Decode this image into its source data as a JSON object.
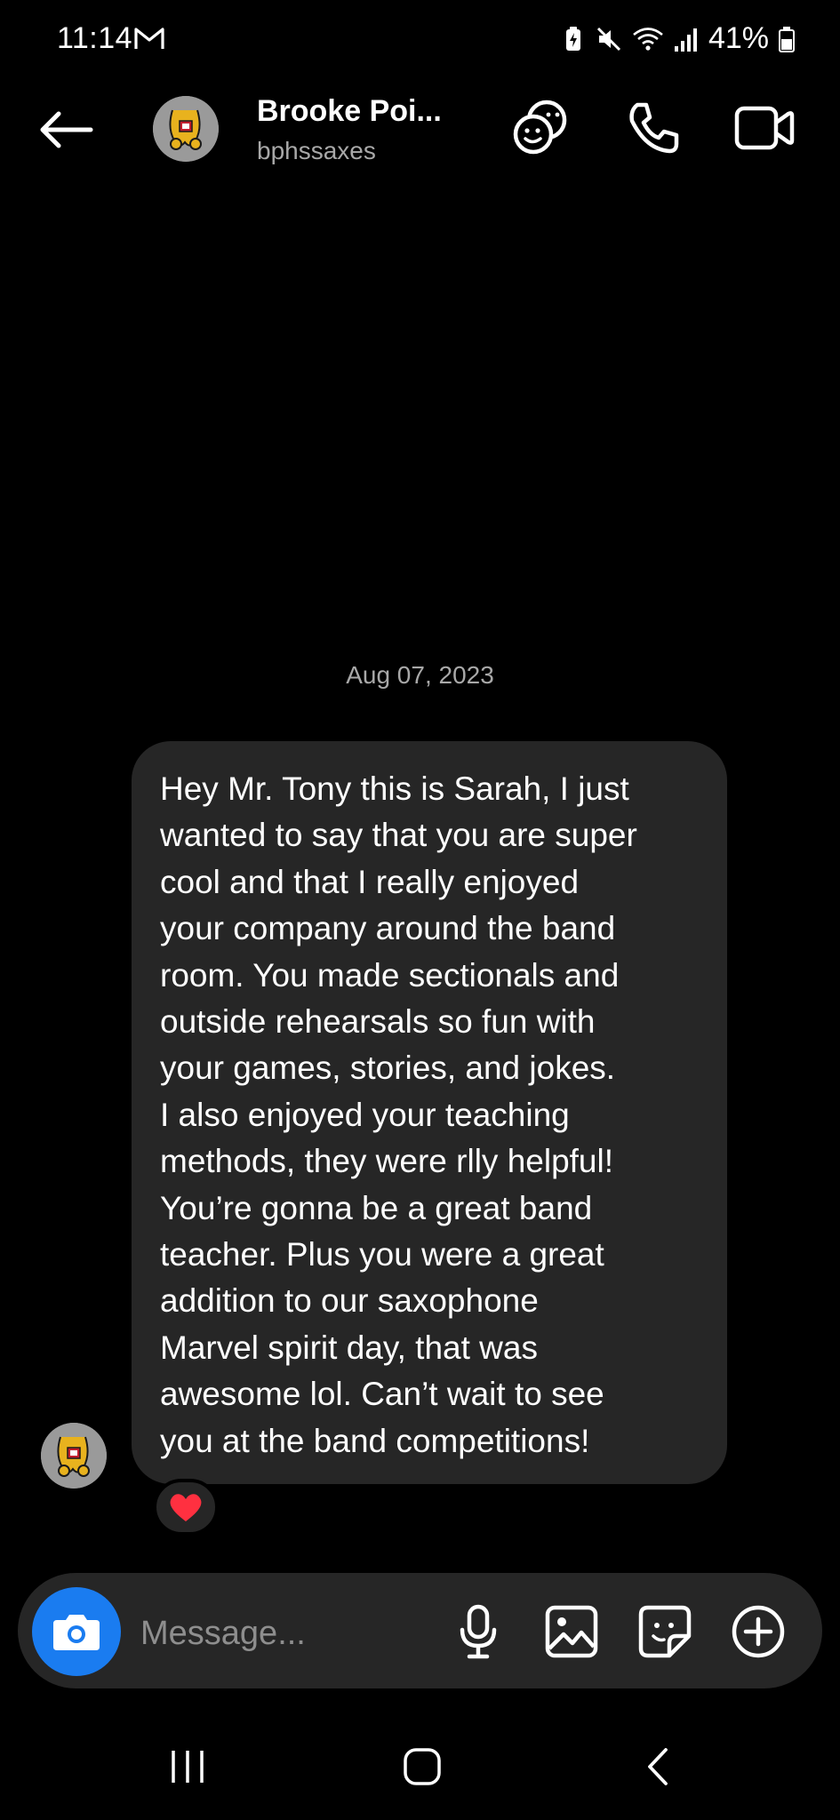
{
  "status_bar": {
    "time": "11:14",
    "battery": "41%",
    "icons": [
      "gmail-icon",
      "battery-saver-icon",
      "mute-icon",
      "wifi-icon",
      "signal-icon",
      "battery-icon"
    ]
  },
  "header": {
    "contact_name": "Brooke Poi...",
    "contact_handle": "bphssaxes",
    "icons": [
      "back-arrow-icon",
      "avatar",
      "stickers-icon",
      "phone-icon",
      "video-icon"
    ]
  },
  "conversation": {
    "date": "Aug 07, 2023",
    "message": "Hey Mr. Tony this is Sarah, I just\nwanted to say that you are super\ncool and that I really enjoyed\nyour company around the band\nroom. You made sectionals and\noutside rehearsals so fun with\nyour games, stories, and jokes.\nI also enjoyed your teaching\nmethods, they were rlly helpful!\nYou’re gonna be a great band\nteacher. Plus you were a great\naddition to our saxophone\nMarvel spirit day, that was\nawesome lol. Can’t wait to see\nyou at the band competitions!",
    "reaction": "heart-icon"
  },
  "composer": {
    "placeholder": "Message...",
    "icons": [
      "camera-icon",
      "microphone-icon",
      "gallery-icon",
      "sticker-icon",
      "plus-circle-icon"
    ]
  },
  "nav_bar": {
    "icons": [
      "recents-icon",
      "home-icon",
      "back-icon"
    ]
  },
  "colors": {
    "background": "#000000",
    "bubble": "#262626",
    "accent_blue": "#1a7cf0",
    "heart": "#ff3040",
    "muted_text": "#a8a8a8"
  }
}
